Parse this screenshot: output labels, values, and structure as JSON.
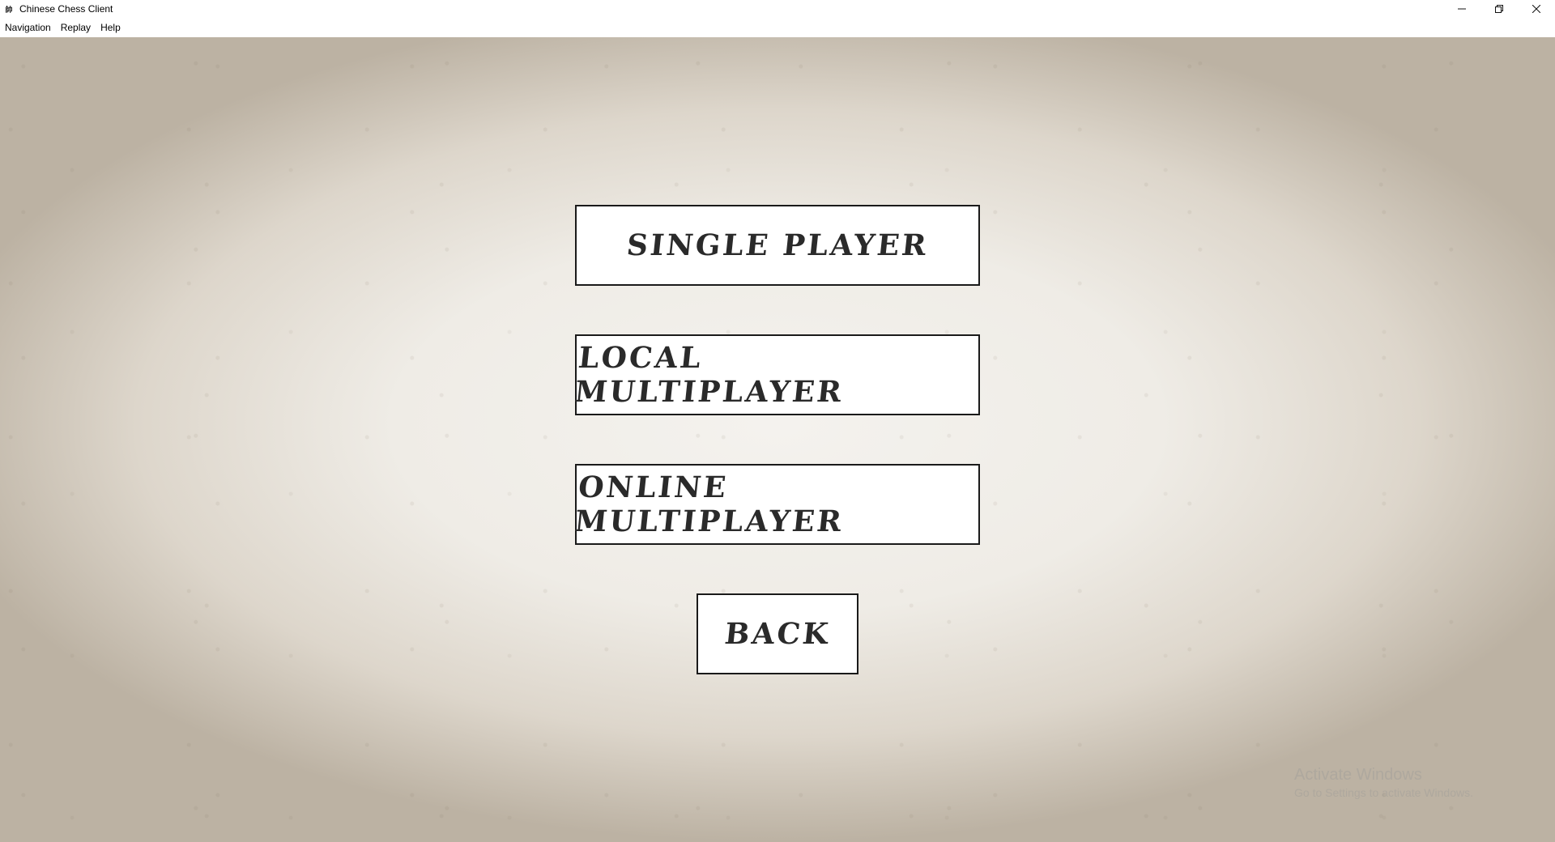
{
  "window": {
    "title": "Chinese Chess Client",
    "icon": "chinese-chess-app-icon",
    "icon_glyph": "帥"
  },
  "controls": {
    "minimize": "minimize-icon",
    "restore": "restore-icon",
    "close": "close-icon"
  },
  "menubar": {
    "items": [
      {
        "label": "Navigation"
      },
      {
        "label": "Replay"
      },
      {
        "label": "Help"
      }
    ]
  },
  "main_menu": {
    "single_player": "Single Player",
    "local_multiplayer": "Local Multiplayer",
    "online_multiplayer": "Online Multiplayer",
    "back": "Back"
  },
  "watermark": {
    "title": "Activate Windows",
    "subtitle": "Go to Settings to activate Windows."
  },
  "colors": {
    "button_background": "#ffffff",
    "button_border": "#1a1a1a",
    "button_text": "#2a2a2a",
    "paper_center": "#f4f2ee",
    "paper_edge": "#bcb2a3"
  }
}
